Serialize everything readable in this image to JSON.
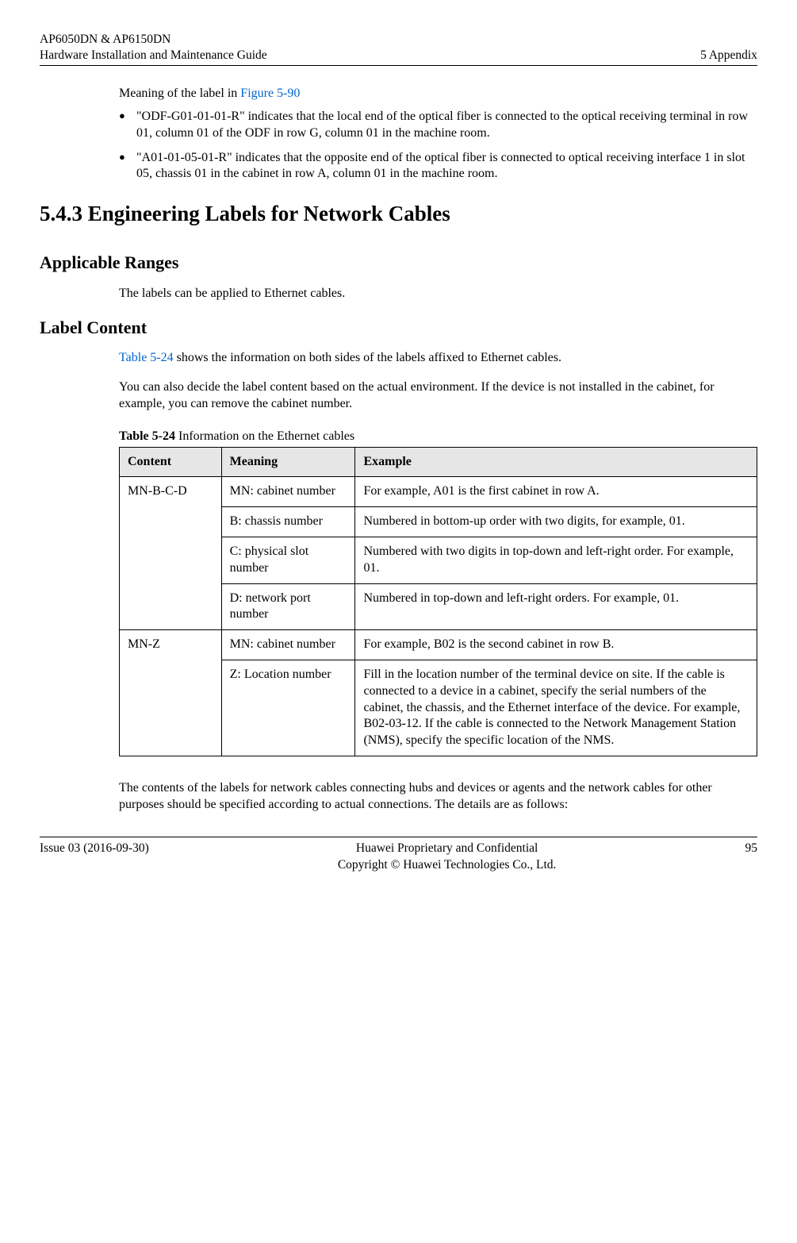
{
  "header": {
    "left1": "AP6050DN & AP6150DN",
    "left2": "Hardware Installation and Maintenance Guide",
    "right": "5 Appendix"
  },
  "intro": {
    "meaning_prefix": "Meaning of the label in ",
    "figure_ref": "Figure 5-90",
    "bullets": [
      "\"ODF-G01-01-01-R\" indicates that the local end of the optical fiber is connected to the optical receiving terminal in row 01, column 01 of the ODF in row G, column 01 in the machine room.",
      "\"A01-01-05-01-R\" indicates that the opposite end of the optical fiber is connected to optical receiving interface 1 in slot 05, chassis 01 in the cabinet in row A, column 01 in the machine room."
    ]
  },
  "section_heading": "5.4.3 Engineering Labels for Network Cables",
  "applicable": {
    "heading": "Applicable Ranges",
    "text": "The labels can be applied to Ethernet cables."
  },
  "label_content": {
    "heading": "Label Content",
    "para1_pre": "",
    "para1_link": "Table 5-24",
    "para1_post": " shows the information on both sides of the labels affixed to Ethernet cables.",
    "para2": "You can also decide the label content based on the actual environment. If the device is not installed in the cabinet, for example, you can remove the cabinet number."
  },
  "table": {
    "caption_bold": "Table 5-24",
    "caption_rest": " Information on the Ethernet cables",
    "headers": [
      "Content",
      "Meaning",
      "Example"
    ],
    "rows": [
      {
        "content": "MN-B-C-D",
        "meaning": "MN: cabinet number",
        "example": "For example, A01 is the first cabinet in row A."
      },
      {
        "meaning": "B: chassis number",
        "example": "Numbered in bottom-up order with two digits, for example, 01."
      },
      {
        "meaning": "C: physical slot number",
        "example": "Numbered with two digits in top-down and left-right order. For example, 01."
      },
      {
        "meaning": "D: network port number",
        "example": "Numbered in top-down and left-right orders. For example, 01."
      },
      {
        "content": "MN-Z",
        "meaning": "MN: cabinet number",
        "example": "For example, B02 is the second cabinet in row B."
      },
      {
        "meaning": "Z: Location number",
        "example": "Fill in the location number of the terminal device on site. If the cable is connected to a device in a cabinet, specify the serial numbers of the cabinet, the chassis, and the Ethernet interface of the device. For example, B02-03-12. If the cable is connected to the Network Management Station (NMS), specify the specific location of the NMS."
      }
    ]
  },
  "closing_para": "The contents of the labels for network cables connecting hubs and devices or agents and the network cables for other purposes should be specified according to actual connections. The details are as follows:",
  "footer": {
    "left": "Issue 03 (2016-09-30)",
    "center1": "Huawei Proprietary and Confidential",
    "center2": "Copyright © Huawei Technologies Co., Ltd.",
    "right": "95"
  }
}
